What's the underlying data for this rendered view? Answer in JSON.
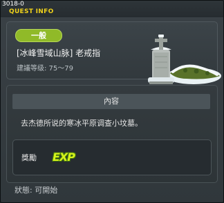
{
  "window": {
    "quest_id": "3018-0",
    "title": "QUEST INFO"
  },
  "info": {
    "category": "一般",
    "name": "[冰峰雪域山脉] 老戒指",
    "level": "建議等级: 75～79",
    "image_icon": "snow-covered-tombstone-icon"
  },
  "content": {
    "header": "內容",
    "description": "去杰德所说的寒冰平原调查小坟墓。",
    "reward_label": "獎勵",
    "reward_icon_text": "EXP"
  },
  "status": "狀態: 可開始",
  "colors": {
    "title": "#f0d21a",
    "badge": "#90ba28",
    "exp": "#d6f31b"
  }
}
